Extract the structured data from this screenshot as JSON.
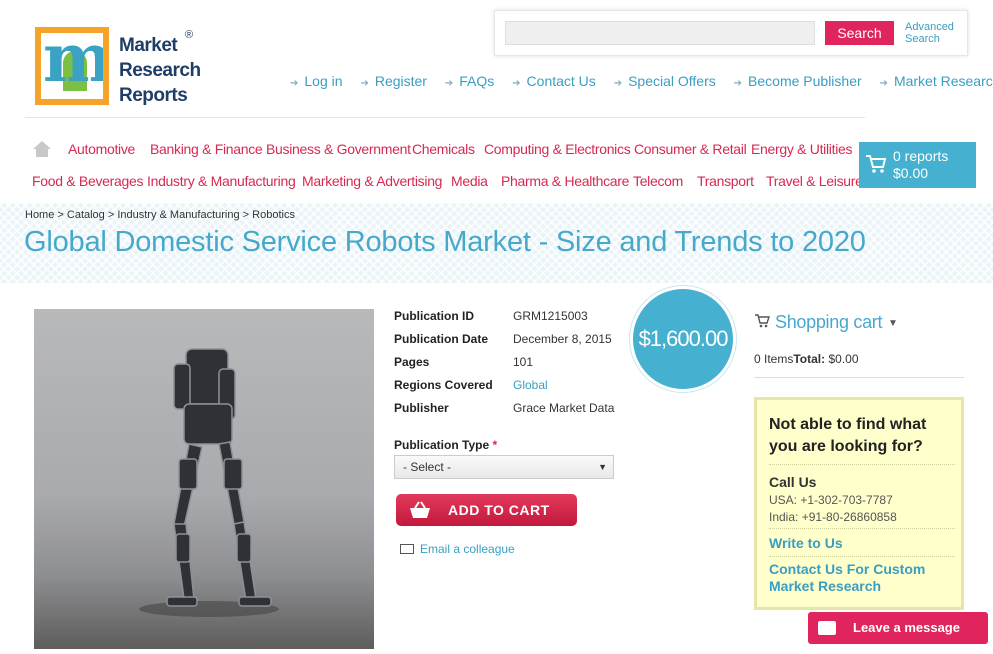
{
  "logo": {
    "lines": [
      "Market",
      "Research",
      "Reports"
    ],
    "registered": "®"
  },
  "search": {
    "button": "Search",
    "advanced_line1": "Advanced",
    "advanced_line2": "Search"
  },
  "top_links": [
    "Log in",
    "Register",
    "FAQs",
    "Contact Us",
    "Special Offers",
    "Become Publisher",
    "Market Research Blog"
  ],
  "categories_row1": [
    "Automotive",
    "Banking & Finance",
    "Business & Government",
    "Chemicals",
    "Computing & Electronics",
    "Consumer & Retail",
    "Energy & Utilities"
  ],
  "categories_row2": [
    "Food & Beverages",
    "Industry & Manufacturing",
    "Marketing & Advertising",
    "Media",
    "Pharma & Healthcare",
    "Telecom",
    "Transport",
    "Travel & Leisure"
  ],
  "cart": {
    "count": "0 reports",
    "total": "$0.00"
  },
  "breadcrumb": "Home > Catalog > Industry & Manufacturing > Robotics",
  "title": "Global Domestic Service Robots Market - Size and Trends to 2020",
  "details": [
    {
      "label": "Publication ID",
      "value": "GRM1215003"
    },
    {
      "label": "Publication Date",
      "value": "December 8, 2015"
    },
    {
      "label": "Pages",
      "value": "101"
    },
    {
      "label": "Regions Covered",
      "value": "Global"
    },
    {
      "label": "Publisher",
      "value": "Grace Market Data"
    }
  ],
  "price": "$1,600.00",
  "publication_type": {
    "label": "Publication Type",
    "required_mark": "*",
    "selected": "- Select -"
  },
  "add_to_cart": "ADD TO CART",
  "email_colleague": "Email a colleague",
  "shopping_cart": {
    "title": "Shopping cart",
    "items": "0 Items",
    "total_label": "Total:",
    "total_value": "$0.00"
  },
  "help_box": {
    "title": "Not able to find what you are looking for?",
    "call_title": "Call Us",
    "usa": "USA: +1-302-703-7787",
    "india": "India: +91-80-26860858",
    "write": "Write to Us",
    "custom": "Contact Us For Custom Market Research"
  },
  "leave_message": "Leave a message",
  "colors": {
    "accent_blue": "#46a9cc",
    "accent_pink": "#e0245e",
    "category_red": "#d6294f"
  }
}
